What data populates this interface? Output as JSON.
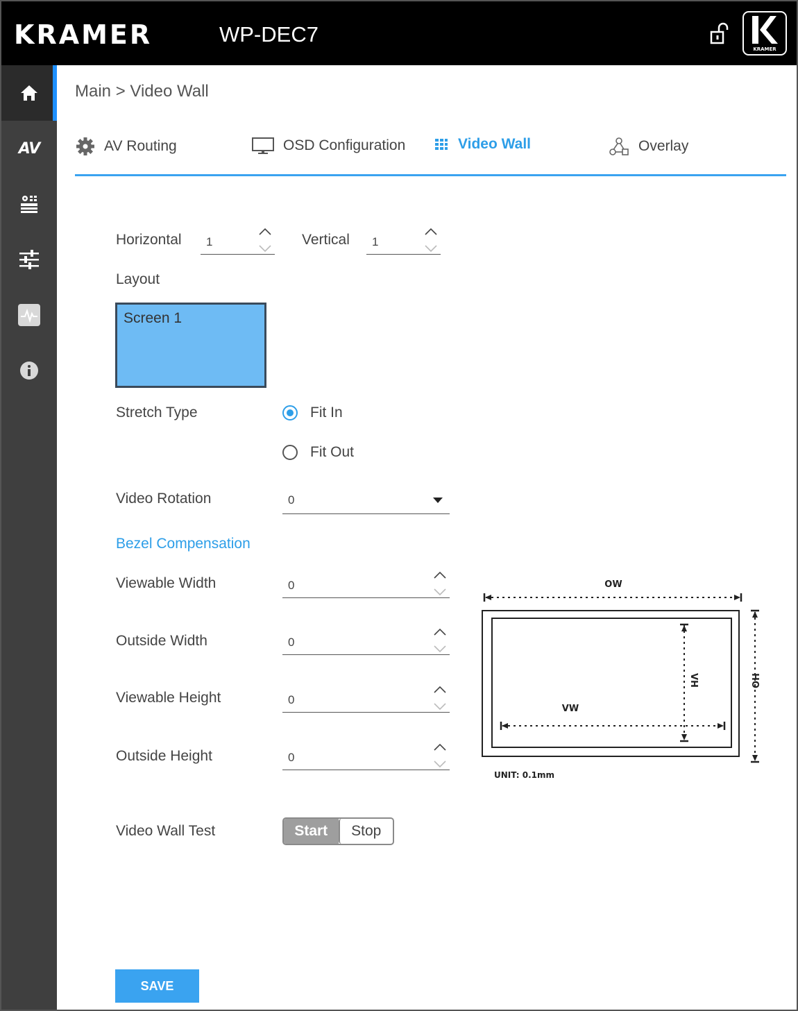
{
  "header": {
    "brand": "KRAMER",
    "model": "WP-DEC7",
    "logo_text": "KRAMER"
  },
  "sidebar": {
    "items": [
      {
        "id": "home",
        "icon": "home-icon",
        "active": true
      },
      {
        "id": "av",
        "icon": "av-icon",
        "label": "AV"
      },
      {
        "id": "device",
        "icon": "device-settings-icon"
      },
      {
        "id": "settings",
        "icon": "sliders-icon"
      },
      {
        "id": "diagnostics",
        "icon": "pulse-icon"
      },
      {
        "id": "info",
        "icon": "info-icon"
      }
    ]
  },
  "breadcrumb": "Main > Video Wall",
  "tabs": [
    {
      "label": "AV Routing",
      "icon": "gear-icon",
      "active": false
    },
    {
      "label": "OSD Configuration",
      "icon": "monitor-icon",
      "active": false
    },
    {
      "label": "Video Wall",
      "icon": "grid-icon",
      "active": true
    },
    {
      "label": "Overlay",
      "icon": "overlay-icon",
      "active": false
    }
  ],
  "form": {
    "horizontal_label": "Horizontal",
    "horizontal_value": "1",
    "vertical_label": "Vertical",
    "vertical_value": "1",
    "layout_label": "Layout",
    "screen_label": "Screen 1",
    "stretch_label": "Stretch Type",
    "stretch_options": [
      "Fit In",
      "Fit Out"
    ],
    "stretch_selected": "Fit In",
    "rotation_label": "Video Rotation",
    "rotation_value": "0",
    "bezel_label": "Bezel Compensation",
    "viewable_width_label": "Viewable Width",
    "viewable_width_value": "0",
    "outside_width_label": "Outside Width",
    "outside_width_value": "0",
    "viewable_height_label": "Viewable Height",
    "viewable_height_value": "0",
    "outside_height_label": "Outside Height",
    "outside_height_value": "0",
    "test_label": "Video Wall Test",
    "test_start": "Start",
    "test_stop": "Stop",
    "save_label": "SAVE"
  },
  "diagram": {
    "ow": "OW",
    "oh": "OH",
    "vw": "VW",
    "vh": "VH",
    "unit": "UNIT: 0.1mm"
  },
  "colors": {
    "accent": "#2d9ee8",
    "screen_fill": "#6ebbf4",
    "sidebar": "#3f3f3f",
    "header": "#000000"
  }
}
